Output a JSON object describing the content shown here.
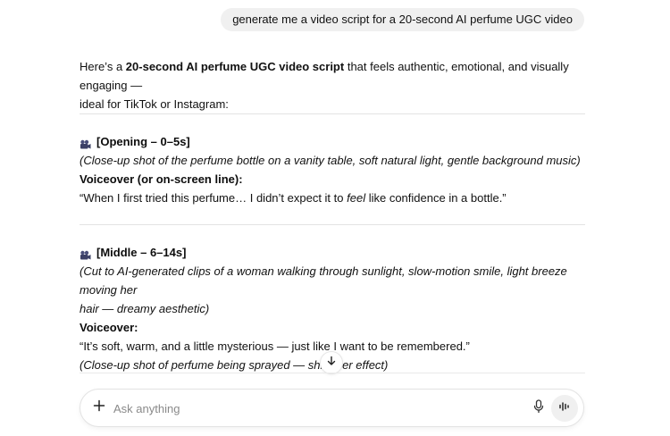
{
  "user_message": "generate me a video script for a 20-second AI perfume UGC video",
  "intro": {
    "before": "Here’s a ",
    "bold": "20-second AI perfume UGC video script",
    "after_line1": " that feels authentic, emotional, and visually engaging —",
    "line2": "ideal for TikTok or Instagram:"
  },
  "sections": [
    {
      "title": "[Opening – 0–5s]",
      "direction": "(Close-up shot of the perfume bottle on a vanity table, soft natural light, gentle background music)",
      "vo_label": "Voiceover (or on-screen line):",
      "vo_before": "“When I first tried this perfume… I didn’t expect it to ",
      "vo_em": "feel",
      "vo_after": " like confidence in a bottle.”"
    },
    {
      "title": "[Middle – 6–14s]",
      "direction_line1": "(Cut to AI-generated clips of a woman walking through sunlight, slow-motion smile, light breeze moving her",
      "direction_line2": "hair — dreamy aesthetic)",
      "vo_label": "Voiceover:",
      "vo_text": "“It’s soft, warm, and a little mysterious — just like I want to be remembered.”",
      "direction2": "(Close-up shot of perfume being sprayed — shimmer effect)"
    }
  ],
  "composer": {
    "placeholder": "Ask anything"
  },
  "icons": {
    "section": "movie-camera-icon",
    "scroll": "arrow-down-icon",
    "add": "plus-icon",
    "mic": "microphone-icon",
    "voice": "voice-waveform-icon"
  }
}
